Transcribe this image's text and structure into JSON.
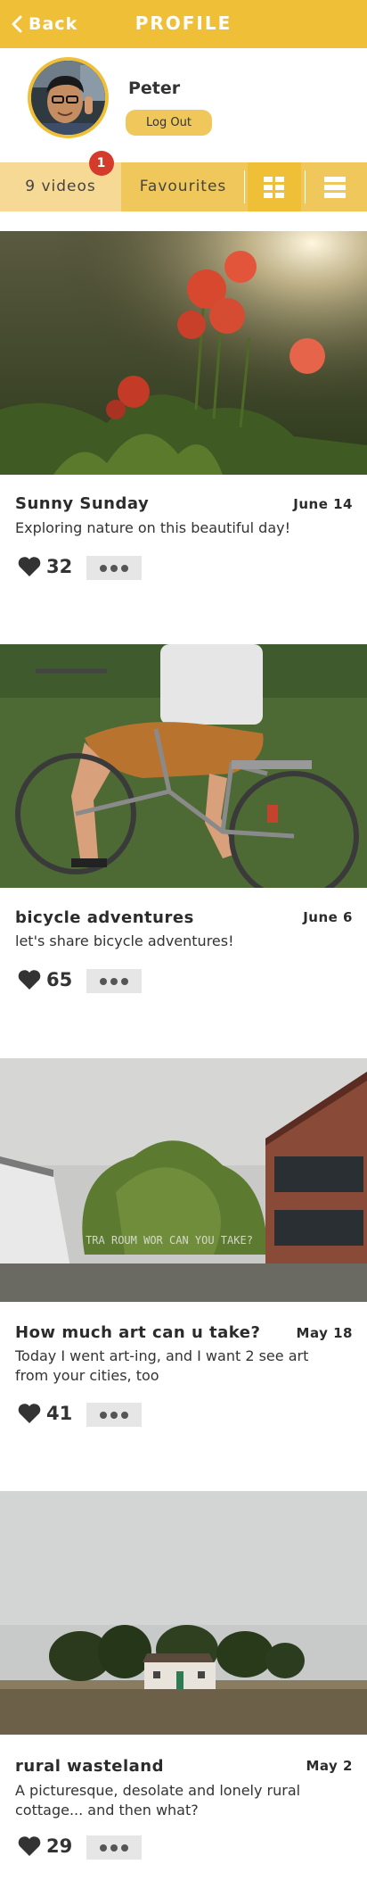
{
  "header": {
    "back_label": "Back",
    "title": "PROFILE"
  },
  "profile": {
    "name": "Peter",
    "logout_label": "Log Out"
  },
  "tabs": {
    "videos_label": "9 videos",
    "videos_badge": "1",
    "favourites_label": "Favourites",
    "grid_view_icon": "grid-icon",
    "list_view_icon": "list-icon",
    "active_view": "grid"
  },
  "colors": {
    "accent": "#f0bf38",
    "accent_light": "#f0c75a",
    "badge": "#d43b2b"
  },
  "posts": [
    {
      "title": "Sunny Sunday",
      "date": "June 14",
      "description": "Exploring nature on this beautiful day!",
      "likes": "32"
    },
    {
      "title": "bicycle adventures",
      "date": "June 6",
      "description": "let's share bicycle adventures!",
      "likes": "65"
    },
    {
      "title": "How much art can u take?",
      "date": "May 18",
      "description": "Today I went art-ing, and I want 2 see art from your cities, too",
      "likes": "41",
      "photo_text": "TRA ROUM WOR CAN YOU TAKE?"
    },
    {
      "title": "rural wasteland",
      "date": "May 2",
      "description": "A picturesque, desolate and lonely rural cottage... and then what?",
      "likes": "29"
    }
  ]
}
